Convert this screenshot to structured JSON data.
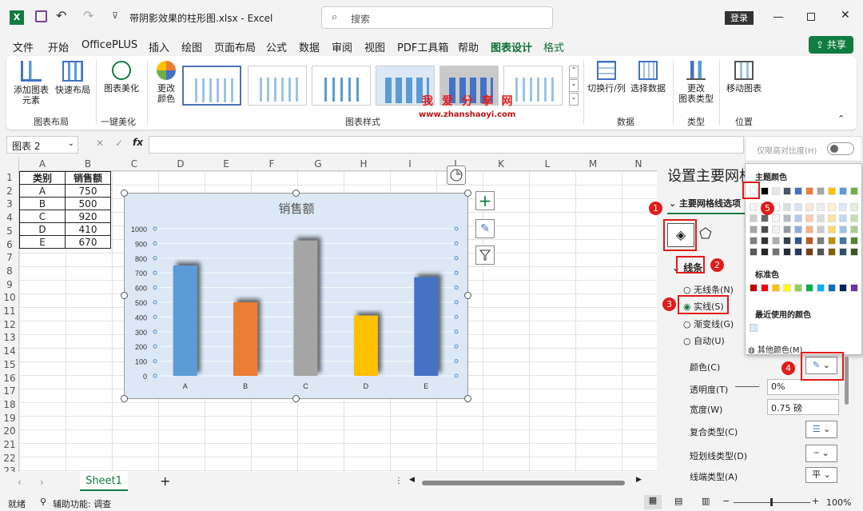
{
  "titlebar": {
    "filename": "带阴影效果的柱形图.xlsx",
    "app": "Excel",
    "search_placeholder": "搜索",
    "login": "登录",
    "share": "共享"
  },
  "menu": [
    "文件",
    "开始",
    "OfficePLUS",
    "插入",
    "绘图",
    "页面布局",
    "公式",
    "数据",
    "审阅",
    "视图",
    "PDF工具箱",
    "帮助",
    "图表设计",
    "格式"
  ],
  "ribbon": {
    "add_element": "添加图表\n元素",
    "quick_layout": "快速布局",
    "beautify": "图表美化",
    "change_colors": "更改\n颜色",
    "switch_rowcol": "切换行/列",
    "select_data": "选择数据",
    "change_type": "更改\n图表类型",
    "move_chart": "移动图表",
    "groups": {
      "layout": "图表布局",
      "onekey": "一键美化",
      "styles": "图表样式",
      "data": "数据",
      "type": "类型",
      "location": "位置"
    },
    "watermark": "我 爱 分 享 网",
    "watermark_url": "www.zhanshaoyi.com"
  },
  "formula": {
    "namebox": "图表 2",
    "fx": "fx"
  },
  "columns": [
    "A",
    "B",
    "C",
    "D",
    "E",
    "F",
    "G",
    "H",
    "I",
    "J",
    "K",
    "L",
    "M",
    "N"
  ],
  "rows": [
    "1",
    "2",
    "3",
    "4",
    "5",
    "6",
    "7",
    "8",
    "9",
    "10",
    "11",
    "12",
    "13",
    "14",
    "15",
    "16",
    "17",
    "18",
    "19",
    "20",
    "21",
    "22",
    "23"
  ],
  "table": {
    "headers": [
      "类别",
      "销售额"
    ],
    "rows": [
      [
        "A",
        "750"
      ],
      [
        "B",
        "500"
      ],
      [
        "C",
        "920"
      ],
      [
        "D",
        "410"
      ],
      [
        "E",
        "670"
      ]
    ]
  },
  "chart_data": {
    "type": "bar",
    "title": "销售额",
    "categories": [
      "A",
      "B",
      "C",
      "D",
      "E"
    ],
    "values": [
      750,
      500,
      920,
      410,
      670
    ],
    "colors": [
      "#5b9bd5",
      "#ed7d31",
      "#a5a5a5",
      "#ffc000",
      "#4472c4"
    ],
    "ylim": [
      0,
      1000
    ],
    "yticks": [
      "0",
      "100",
      "200",
      "300",
      "400",
      "500",
      "600",
      "700",
      "800",
      "900",
      "1000"
    ]
  },
  "panel": {
    "title": "设置主要网格",
    "section": "主要网格线选项",
    "line": "线条",
    "no_line": "无线条(N)",
    "solid": "实线(S)",
    "gradient": "渐变线(G)",
    "auto": "自动(U)",
    "color": "颜色(C)",
    "transparency": "透明度(T)",
    "transparency_val": "0%",
    "width": "宽度(W)",
    "width_val": "0.75 磅",
    "compound": "复合类型(C)",
    "dash": "短划线类型(D)",
    "cap": "线端类型(A)",
    "cap_val": "平"
  },
  "popup": {
    "contrast": "仅限高对比度(H)",
    "theme": "主题颜色",
    "standard": "标准色",
    "recent": "最近使用的颜色",
    "more": "其他颜色(M)...",
    "theme_row": [
      "#ffffff",
      "#000000",
      "#e7e6e6",
      "#44546a",
      "#4472c4",
      "#ed7d31",
      "#a5a5a5",
      "#ffc000",
      "#5b9bd5",
      "#70ad47"
    ],
    "standard_row": [
      "#c00000",
      "#ff0000",
      "#ffc000",
      "#ffff00",
      "#92d050",
      "#00b050",
      "#00b0f0",
      "#0070c0",
      "#002060",
      "#7030a0"
    ],
    "recent_color": "#dce8f5"
  },
  "callouts": [
    "1",
    "2",
    "3",
    "4",
    "5"
  ],
  "sheettab": "Sheet1",
  "status": {
    "ready": "就绪",
    "access": "辅助功能: 调查",
    "zoom": "100%"
  }
}
